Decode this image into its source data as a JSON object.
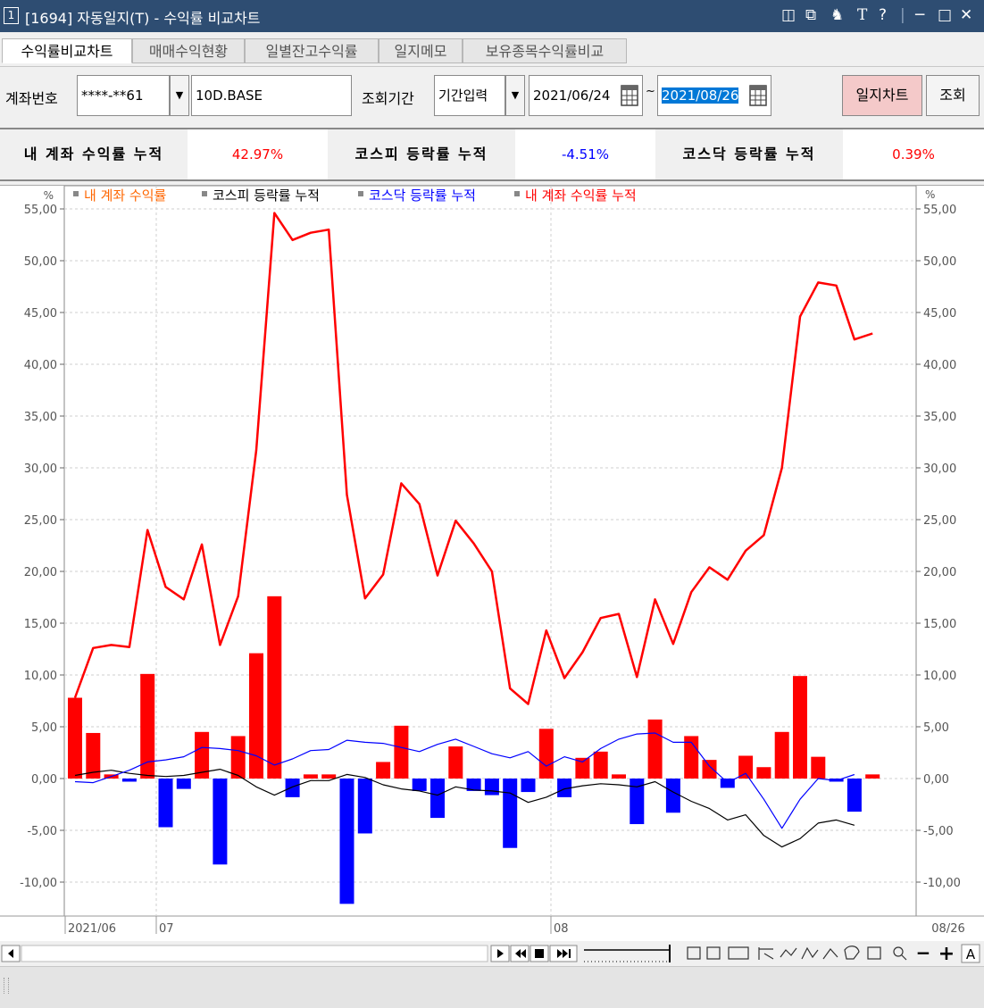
{
  "window": {
    "number": "1",
    "title": "[1694] 자동일지(T) - 수익률 비교차트"
  },
  "tabs": [
    "수익률비교차트",
    "매매수익현황",
    "일별잔고수익률",
    "일지메모",
    "보유종목수익률비교"
  ],
  "toolbar": {
    "account_label": "계좌번호",
    "account_value": "****-**61",
    "account_name": "10D.BASE",
    "period_label": "조회기간",
    "period_mode": "기간입력",
    "start_date": "2021/06/24",
    "tilde": "~",
    "end_date": "2021/08/26",
    "journal_chart_button": "일지차트",
    "query_button": "조회"
  },
  "summary": {
    "my_label": "내 계좌 수익률 누적",
    "my_value": "42.97%",
    "kospi_label": "코스피 등락률 누적",
    "kospi_value": "-4.51%",
    "kosdaq_label": "코스닥 등락률 누적",
    "kosdaq_value": "0.39%"
  },
  "colors": {
    "red": "#ff0000",
    "blue": "#0000ff",
    "black": "#000000",
    "orange": "#ff6600",
    "negative_bar": "#0000ff"
  },
  "chart_data": {
    "type": "line+bar",
    "unit_label": "%",
    "legend": [
      {
        "name": "내 계좌 수익률",
        "color": "#ff6600"
      },
      {
        "name": "코스피 등락률 누적",
        "color": "#000000"
      },
      {
        "name": "코스닥 등락률 누적",
        "color": "#0000ff"
      },
      {
        "name": "내 계좌 수익률 누적",
        "color": "#ff0000"
      }
    ],
    "y_ticks": [
      "55,00",
      "50,00",
      "45,00",
      "40,00",
      "35,00",
      "30,00",
      "25,00",
      "20,00",
      "15,00",
      "10,00",
      "5,00",
      "0,00",
      "-5,00",
      "-10,00"
    ],
    "x_labels": [
      "2021/06",
      "07",
      "08",
      "08/26"
    ],
    "ylim": [
      -12.5,
      55.5
    ],
    "daily_return": [
      7.8,
      4.4,
      0.4,
      -0.3,
      10.1,
      -4.7,
      -1.0,
      4.5,
      -8.3,
      4.1,
      12.1,
      17.6,
      -1.8,
      0.4,
      0.4,
      -12.1,
      -5.3,
      1.6,
      5.1,
      -1.2,
      -3.8,
      3.1,
      -1.2,
      -1.6,
      -6.7,
      -1.3,
      4.8,
      -1.8,
      2.0,
      2.6,
      0.4,
      -4.4,
      5.7,
      -3.3,
      4.1,
      1.8,
      -0.9,
      2.2,
      1.1,
      4.5,
      9.9,
      2.1,
      -0.3,
      -3.2,
      0.4
    ],
    "my_cumulative": [
      7.8,
      12.6,
      12.9,
      12.7,
      24.0,
      18.5,
      17.3,
      22.6,
      12.9,
      17.6,
      31.7,
      54.6,
      52.0,
      52.7,
      53.0,
      27.4,
      17.4,
      19.7,
      28.5,
      26.5,
      19.6,
      24.9,
      22.7,
      20.0,
      8.7,
      7.2,
      14.3,
      9.7,
      12.2,
      15.5,
      15.9,
      9.8,
      17.3,
      13.0,
      18.0,
      20.4,
      19.2,
      22.0,
      23.5,
      30.0,
      44.6,
      47.9,
      47.6,
      42.4,
      42.97
    ],
    "kospi_cumulative": [
      0.3,
      0.6,
      0.8,
      0.5,
      0.3,
      0.2,
      0.3,
      0.6,
      0.9,
      0.3,
      -0.8,
      -1.6,
      -0.8,
      -0.2,
      -0.2,
      0.4,
      0.1,
      -0.6,
      -1.0,
      -1.2,
      -1.6,
      -0.8,
      -1.1,
      -1.2,
      -1.4,
      -2.3,
      -1.8,
      -1.0,
      -0.7,
      -0.5,
      -0.6,
      -0.8,
      -0.3,
      -1.3,
      -2.2,
      -2.9,
      -4.0,
      -3.5,
      -5.5,
      -6.6,
      -5.8,
      -4.3,
      -4.0,
      -4.51
    ],
    "kosdaq_cumulative": [
      -0.3,
      -0.4,
      0.2,
      0.8,
      1.6,
      1.8,
      2.1,
      3.0,
      2.9,
      2.7,
      2.2,
      1.3,
      1.9,
      2.7,
      2.8,
      3.7,
      3.5,
      3.4,
      3.0,
      2.6,
      3.3,
      3.8,
      3.1,
      2.4,
      2.0,
      2.6,
      1.2,
      2.1,
      1.6,
      2.9,
      3.8,
      4.3,
      4.4,
      3.5,
      3.5,
      1.2,
      -0.4,
      0.5,
      -2.0,
      -4.8,
      -2.0,
      0.0,
      -0.2,
      0.39
    ]
  },
  "controls": {
    "zoom_out": "−",
    "zoom_in": "+",
    "text_toggle": "A"
  }
}
